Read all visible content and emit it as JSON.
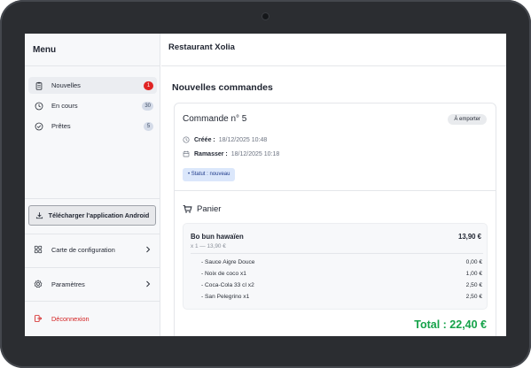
{
  "sidebar": {
    "title": "Menu",
    "nav": [
      {
        "label": "Nouvelles",
        "count": "1"
      },
      {
        "label": "En cours",
        "count": "30"
      },
      {
        "label": "Prêtes",
        "count": "5"
      }
    ],
    "android_button": "Télécharger l'application Android",
    "config_label": "Carte de configuration",
    "settings_label": "Paramètres",
    "logout_label": "Déconnexion"
  },
  "header": {
    "restaurant": "Restaurant Xolia"
  },
  "main": {
    "title": "Nouvelles commandes",
    "order": {
      "title": "Commande n° 5",
      "mode": "À emporter",
      "created_label": "Créée :",
      "created_value": "18/12/2025 10:48",
      "pickup_label": "Ramasser :",
      "pickup_value": "18/12/2025 10:18",
      "status_label": "• Statut :",
      "status_value": "nouveau"
    },
    "cart": {
      "title": "Panier",
      "item": {
        "name": "Bo bun hawaïen",
        "price": "13,90 €",
        "qty": "x 1 — 13,90 €",
        "options": [
          {
            "name": "- Sauce Aigre Douce",
            "price": "0,00 €"
          },
          {
            "name": "- Noix de coco x1",
            "price": "1,00 €"
          },
          {
            "name": "- Coca-Cola 33 cl x2",
            "price": "2,50 €"
          },
          {
            "name": "- San Pelegrino x1",
            "price": "2,50 €"
          }
        ]
      },
      "total": "Total : 22,40 €"
    }
  },
  "colors": {
    "badge_alert": "#e02424",
    "total_green": "#16a34a",
    "logout_red": "#d32020",
    "status_bg": "#dbe7fb"
  },
  "icons": {
    "nouvelles": "clipboard-icon",
    "en_cours": "clock-icon",
    "pretes": "check-circle-icon",
    "android": "download-icon",
    "config": "grid-icon",
    "settings": "gear-icon",
    "logout": "logout-icon",
    "cart": "cart-icon"
  }
}
